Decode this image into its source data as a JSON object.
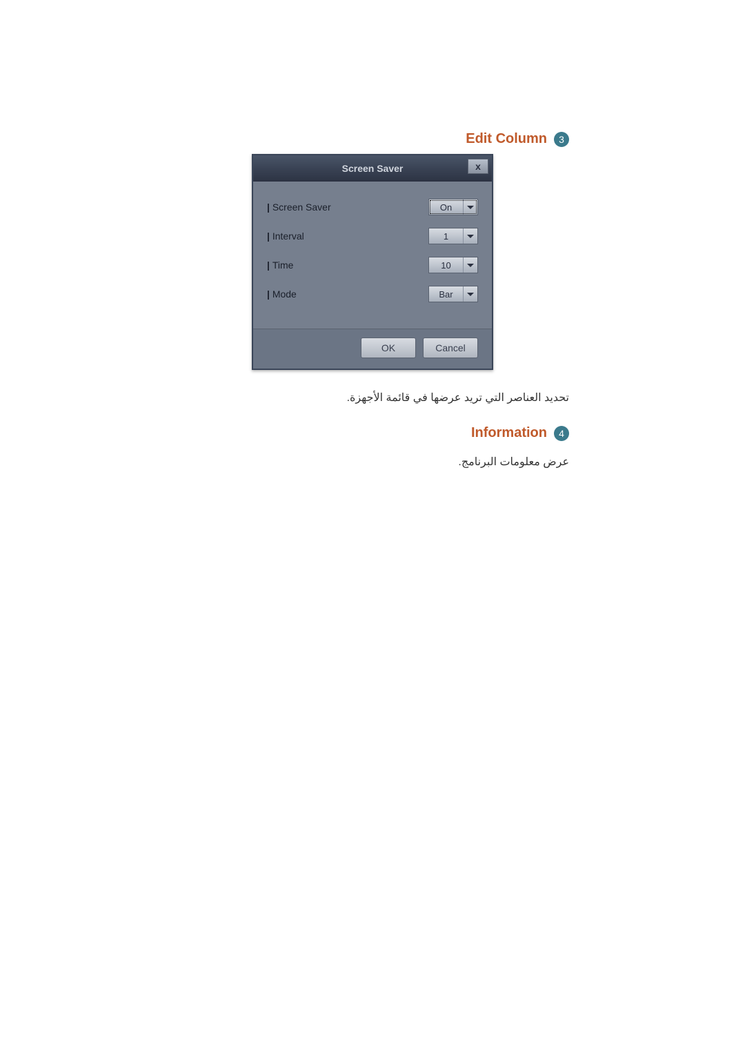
{
  "sections": {
    "editColumn": {
      "title": "Edit Column",
      "number": "3",
      "description": "تحديد العناصر التي تريد عرضها في قائمة الأجهزة."
    },
    "information": {
      "title": "Information",
      "number": "4",
      "description": "عرض معلومات البرنامج."
    }
  },
  "dialog": {
    "title": "Screen Saver",
    "close": "x",
    "rows": {
      "screenSaver": {
        "label": "Screen Saver",
        "value": "On"
      },
      "interval": {
        "label": "Interval",
        "value": "1"
      },
      "time": {
        "label": "Time",
        "value": "10"
      },
      "mode": {
        "label": "Mode",
        "value": "Bar"
      }
    },
    "buttons": {
      "ok": "OK",
      "cancel": "Cancel"
    }
  }
}
